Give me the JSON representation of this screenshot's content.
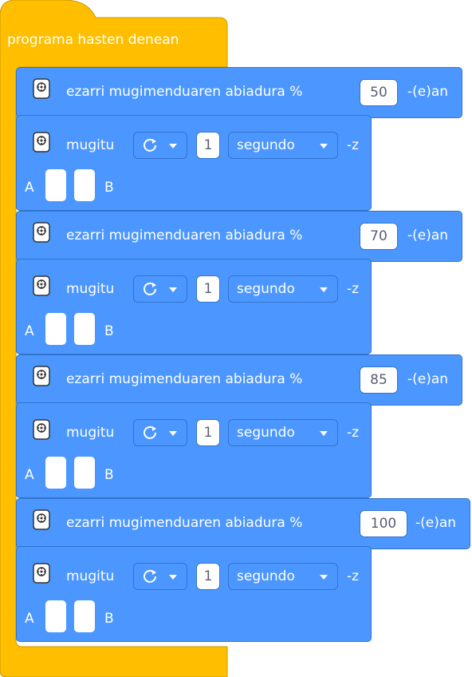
{
  "hat": {
    "label": "programa hasten denean"
  },
  "speed_text": {
    "prefix": "ezarri mugimenduaren abiadura %",
    "suffix": "-(e)an"
  },
  "move_text": {
    "label": "mugitu",
    "duration": "1",
    "unit": "segundo",
    "suffix": "-z",
    "port_a": "A",
    "port_b": "B"
  },
  "icons": {
    "hub": "motor-hub-icon",
    "rotate": "rotate-clockwise-icon",
    "caret": "caret-down-icon"
  },
  "blocks": [
    {
      "speed": "50"
    },
    {
      "speed": "70"
    },
    {
      "speed": "85"
    },
    {
      "speed": "100"
    }
  ],
  "colors": {
    "hat": "#FFBF00",
    "hat_border": "#CC9900",
    "motion": "#4C97FF",
    "motion_border": "#3373CC"
  }
}
